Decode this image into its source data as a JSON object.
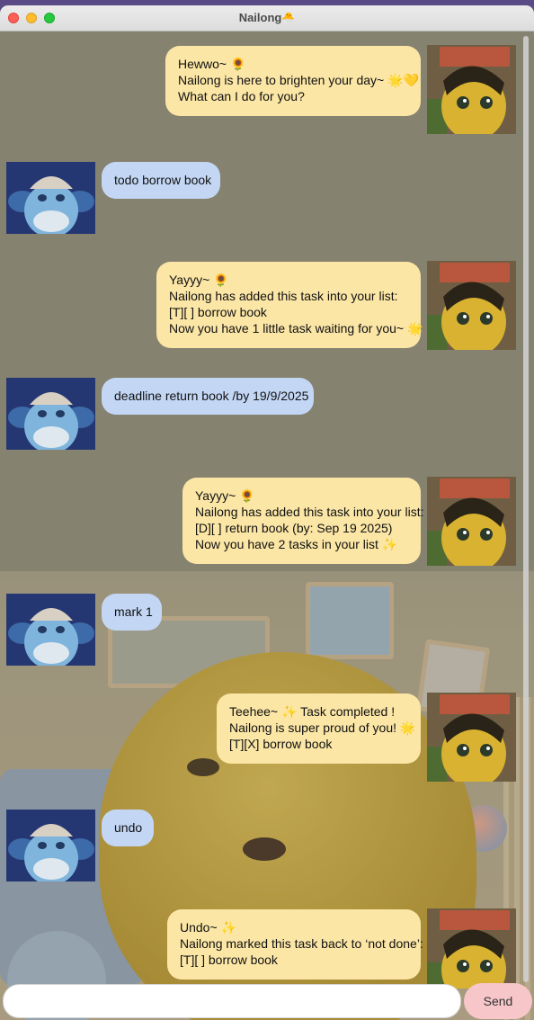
{
  "window": {
    "title": "Nailong",
    "title_icon": "🐣"
  },
  "messages": [
    {
      "sender": "bot",
      "lines": [
        "Hewwo~ 🌻",
        "Nailong is here to brighten your day~ 🌟💛",
        "What can I do for you?"
      ]
    },
    {
      "sender": "user",
      "lines": [
        "todo borrow book"
      ]
    },
    {
      "sender": "bot",
      "lines": [
        "Yayyy~ 🌻",
        "Nailong has added this task into your list:",
        "[T][ ] borrow book",
        "Now you have 1 little task waiting for you~ 🌟"
      ]
    },
    {
      "sender": "user",
      "lines": [
        "deadline return book /by 19/9/2025"
      ]
    },
    {
      "sender": "bot",
      "lines": [
        "Yayyy~ 🌻",
        "Nailong has added this task into your list:",
        "[D][ ] return book (by: Sep 19 2025)",
        "Now you have 2 tasks in your list ✨"
      ]
    },
    {
      "sender": "user",
      "lines": [
        "mark 1"
      ]
    },
    {
      "sender": "bot",
      "lines": [
        "Teehee~ ✨ Task completed !",
        "Nailong is super proud of you! 🌟",
        "[T][X] borrow book"
      ]
    },
    {
      "sender": "user",
      "lines": [
        "undo"
      ]
    },
    {
      "sender": "bot",
      "lines": [
        "Undo~ ✨",
        "Nailong marked this task back to ‘not done’:",
        "[T][ ] borrow book"
      ]
    }
  ],
  "input": {
    "value": "",
    "placeholder": ""
  },
  "send_button": {
    "label": "Send"
  },
  "colors": {
    "bot_bubble": "#fbe6a6",
    "user_bubble": "#c3d7f5",
    "send_button": "#f6c6c9"
  }
}
